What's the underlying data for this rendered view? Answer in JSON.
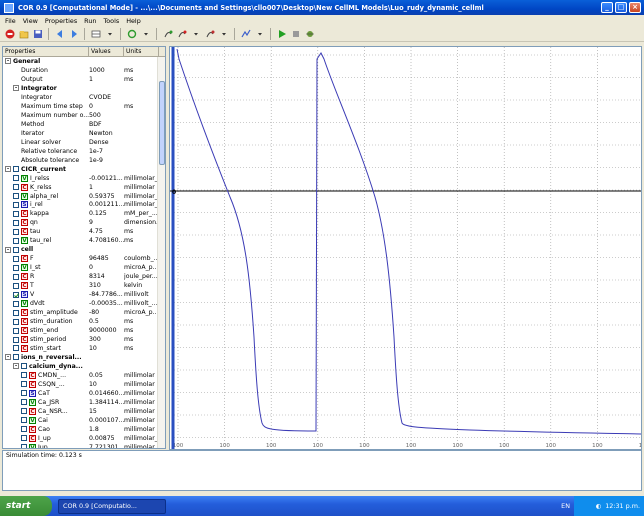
{
  "window": {
    "title": "COR 0.9 [Computational Mode] - ...\\...\\Documents and Settings\\cllo007\\Desktop\\New CellML Models\\Luo_rudy_dynamic_cellml",
    "min": "_",
    "max": "□",
    "close": "×"
  },
  "menu": [
    "File",
    "View",
    "Properties",
    "Run",
    "Tools",
    "Help"
  ],
  "toolbar_icons": [
    "stop-icon",
    "open-icon",
    "save-icon",
    "back-icon",
    "forward-icon",
    "layout-icon",
    "refresh-icon",
    "add-icon",
    "remove-icon",
    "link-icon",
    "run-icon",
    "pause-icon",
    "debug-icon"
  ],
  "properties": {
    "headers": [
      "Properties",
      "Values",
      "Units"
    ],
    "rows": [
      {
        "level": 0,
        "toggle": "-",
        "label": "General",
        "value": "",
        "units": "",
        "group": true
      },
      {
        "level": 2,
        "label": "Duration",
        "value": "1000",
        "units": "ms"
      },
      {
        "level": 2,
        "label": "Output",
        "value": "1",
        "units": "ms"
      },
      {
        "level": 1,
        "toggle": "-",
        "label": "Integrator",
        "value": "",
        "units": "",
        "group": true
      },
      {
        "level": 2,
        "label": "Integrator",
        "value": "CVODE",
        "units": ""
      },
      {
        "level": 2,
        "label": "Maximum time step",
        "value": "0",
        "units": "ms"
      },
      {
        "level": 2,
        "label": "Maximum number o...",
        "value": "500",
        "units": ""
      },
      {
        "level": 2,
        "label": "Method",
        "value": "BDF",
        "units": ""
      },
      {
        "level": 2,
        "label": "Iterator",
        "value": "Newton",
        "units": ""
      },
      {
        "level": 2,
        "label": "Linear solver",
        "value": "Dense",
        "units": ""
      },
      {
        "level": 2,
        "label": "Relative tolerance",
        "value": "1e-7",
        "units": ""
      },
      {
        "level": 2,
        "label": "Absolute tolerance",
        "value": "1e-9",
        "units": ""
      },
      {
        "level": 0,
        "toggle": "-",
        "check": true,
        "label": "CICR_current",
        "value": "",
        "units": "",
        "group": true
      },
      {
        "level": 1,
        "check": true,
        "badge": "V",
        "label": "I_relss",
        "value": "-0.00121...",
        "units": "millimolar_..."
      },
      {
        "level": 1,
        "check": true,
        "badge": "C",
        "label": "K_relss",
        "value": "1",
        "units": "millimolar"
      },
      {
        "level": 1,
        "check": true,
        "badge": "V",
        "label": "alpha_rel",
        "value": "0.59375",
        "units": "millimolar_..."
      },
      {
        "level": 1,
        "check": true,
        "badge": "S",
        "label": "i_rel",
        "value": "0.001211...",
        "units": "millimolar_..."
      },
      {
        "level": 1,
        "check": true,
        "badge": "C",
        "label": "kappa",
        "value": "0.125",
        "units": "mM_per_..."
      },
      {
        "level": 1,
        "check": true,
        "badge": "C",
        "label": "qn",
        "value": "9",
        "units": "dimension..."
      },
      {
        "level": 1,
        "check": true,
        "badge": "C",
        "label": "tau",
        "value": "4.75",
        "units": "ms"
      },
      {
        "level": 1,
        "check": true,
        "badge": "V",
        "label": "tau_rel",
        "value": "4.708160...",
        "units": "ms"
      },
      {
        "level": 0,
        "toggle": "-",
        "check": true,
        "label": "cell",
        "value": "",
        "units": "",
        "group": true
      },
      {
        "level": 1,
        "check": true,
        "badge": "C",
        "label": "F",
        "value": "96485",
        "units": "coulomb_..."
      },
      {
        "level": 1,
        "check": true,
        "badge": "V",
        "label": "I_st",
        "value": "0",
        "units": "microA_p..."
      },
      {
        "level": 1,
        "check": true,
        "badge": "C",
        "label": "R",
        "value": "8314",
        "units": "joule_per..."
      },
      {
        "level": 1,
        "check": true,
        "badge": "C",
        "label": "T",
        "value": "310",
        "units": "kelvin"
      },
      {
        "level": 1,
        "check": true,
        "checked": true,
        "badge": "S",
        "label": "V",
        "value": "-84.7786...",
        "units": "millivolt"
      },
      {
        "level": 1,
        "check": true,
        "badge": "V",
        "label": "dVdt",
        "value": "-0.00035...",
        "units": "millivolt_..."
      },
      {
        "level": 1,
        "check": true,
        "badge": "C",
        "label": "stim_amplitude",
        "value": "-80",
        "units": "microA_p..."
      },
      {
        "level": 1,
        "check": true,
        "badge": "C",
        "label": "stim_duration",
        "value": "0.5",
        "units": "ms"
      },
      {
        "level": 1,
        "check": true,
        "badge": "C",
        "label": "stim_end",
        "value": "9000000",
        "units": "ms"
      },
      {
        "level": 1,
        "check": true,
        "badge": "C",
        "label": "stim_period",
        "value": "300",
        "units": "ms"
      },
      {
        "level": 1,
        "check": true,
        "badge": "C",
        "label": "stim_start",
        "value": "10",
        "units": "ms"
      },
      {
        "level": 0,
        "toggle": "-",
        "check": true,
        "label": "ions_n_reversal...",
        "value": "",
        "units": "",
        "group": true
      },
      {
        "level": 1,
        "toggle": "-",
        "check": true,
        "label": "calcium_dyna...",
        "value": "",
        "units": "",
        "group": true
      },
      {
        "level": 2,
        "check": true,
        "badge": "C",
        "label": "CMDN_...",
        "value": "0.05",
        "units": "millimolar"
      },
      {
        "level": 2,
        "check": true,
        "badge": "C",
        "label": "CSQN_...",
        "value": "10",
        "units": "millimolar"
      },
      {
        "level": 2,
        "check": true,
        "badge": "S",
        "label": "CaT",
        "value": "0.014660...",
        "units": "millimolar"
      },
      {
        "level": 2,
        "check": true,
        "badge": "V",
        "label": "Ca_JSR",
        "value": "1.384114...",
        "units": "millimolar"
      },
      {
        "level": 2,
        "check": true,
        "badge": "C",
        "label": "Ca_NSR...",
        "value": "15",
        "units": "millimolar"
      },
      {
        "level": 2,
        "check": true,
        "badge": "V",
        "label": "Cai",
        "value": "0.000107...",
        "units": "millimolar"
      },
      {
        "level": 2,
        "check": true,
        "badge": "C",
        "label": "Cao",
        "value": "1.8",
        "units": "millimolar"
      },
      {
        "level": 2,
        "check": true,
        "badge": "C",
        "label": "I_up",
        "value": "0.00875",
        "units": "millimolar_..."
      },
      {
        "level": 2,
        "check": true,
        "badge": "V",
        "label": "Jup",
        "value": "7.721301...",
        "units": "millimolar..."
      }
    ]
  },
  "graph": {
    "axis_label": "0",
    "x_tick_label": "100",
    "trace_color": "#3b3bb5",
    "axis_color": "#000000",
    "grid_color": "#9a9a9a"
  },
  "output": {
    "line": "Simulation time: 0.123 s"
  },
  "taskbar": {
    "start": "start",
    "task": "COR 0.9 [Computatio...",
    "lang": "EN",
    "clock": "12:31 p.m."
  }
}
